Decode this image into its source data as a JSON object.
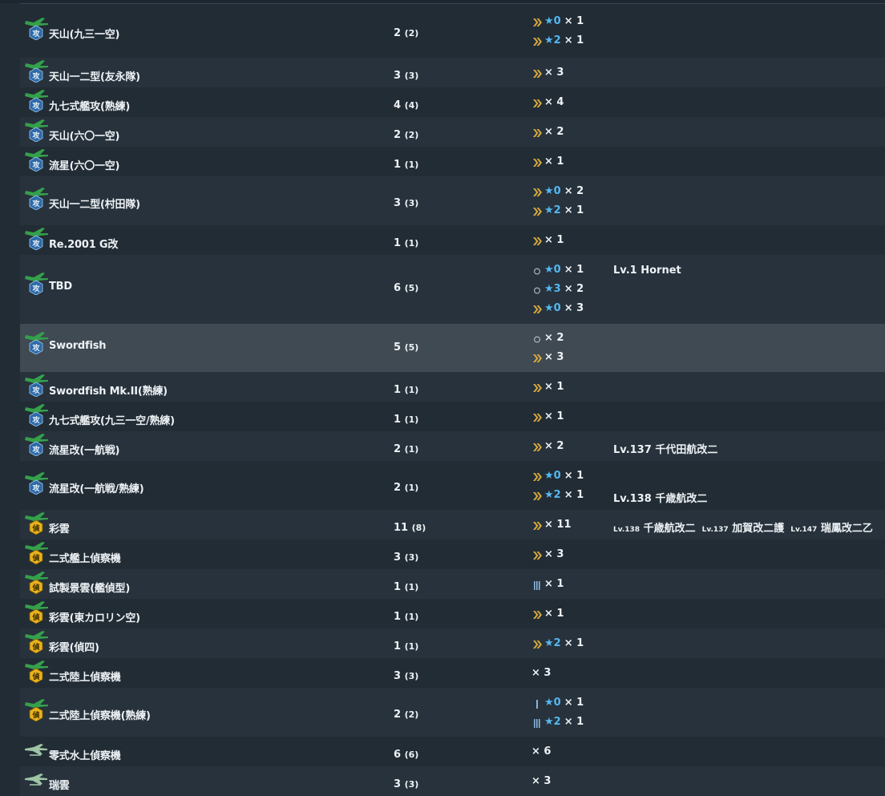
{
  "colors": {
    "background": "#222c35",
    "row_alt": "#27323c",
    "row_hover": "#404a53",
    "star": "#55b7f0",
    "proficiency_chevron": "#d8ab3c",
    "proficiency_bar": "#8ab4dc",
    "torpedo_badge": "#2e6aa8",
    "recon_badge": "#e8b21c",
    "plane": "#35a04b",
    "seaplane": "#9fc4a6"
  },
  "rows": [
    {
      "name": "天山(九三一空)",
      "count": "2",
      "count_paren": "(2)",
      "icon": "torpedo-bomber-icon",
      "prof": [
        {
          "icon": "chevron",
          "star": "★0",
          "mult": "× 1"
        },
        {
          "icon": "chevron",
          "star": "★2",
          "mult": "× 1"
        }
      ],
      "owners": []
    },
    {
      "name": "天山一二型(友永隊)",
      "count": "3",
      "count_paren": "(3)",
      "icon": "torpedo-bomber-icon",
      "prof": [
        {
          "icon": "chevron",
          "star": "",
          "mult": "× 3"
        }
      ],
      "owners": []
    },
    {
      "name": "九七式艦攻(熟練)",
      "count": "4",
      "count_paren": "(4)",
      "icon": "torpedo-bomber-icon",
      "prof": [
        {
          "icon": "chevron",
          "star": "",
          "mult": "× 4"
        }
      ],
      "owners": []
    },
    {
      "name": "天山(六〇一空)",
      "count": "2",
      "count_paren": "(2)",
      "icon": "torpedo-bomber-icon",
      "prof": [
        {
          "icon": "chevron",
          "star": "",
          "mult": "× 2"
        }
      ],
      "owners": []
    },
    {
      "name": "流星(六〇一空)",
      "count": "1",
      "count_paren": "(1)",
      "icon": "torpedo-bomber-icon",
      "prof": [
        {
          "icon": "chevron",
          "star": "",
          "mult": "× 1"
        }
      ],
      "owners": []
    },
    {
      "name": "天山一二型(村田隊)",
      "count": "3",
      "count_paren": "(3)",
      "icon": "torpedo-bomber-icon",
      "prof": [
        {
          "icon": "chevron",
          "star": "★0",
          "mult": "× 2"
        },
        {
          "icon": "chevron",
          "star": "★2",
          "mult": "× 1"
        }
      ],
      "owners": []
    },
    {
      "name": "Re.2001 G改",
      "count": "1",
      "count_paren": "(1)",
      "icon": "torpedo-bomber-icon",
      "prof": [
        {
          "icon": "chevron",
          "star": "",
          "mult": "× 1"
        }
      ],
      "owners": []
    },
    {
      "name": "TBD",
      "count": "6",
      "count_paren": "(5)",
      "icon": "torpedo-bomber-icon",
      "prof": [
        {
          "icon": "circle",
          "star": "★0",
          "mult": "× 1",
          "owner": {
            "lv": "Lv.1",
            "ship": "Hornet"
          }
        },
        {
          "icon": "circle",
          "star": "★3",
          "mult": "× 2"
        },
        {
          "icon": "chevron",
          "star": "★0",
          "mult": "× 3"
        }
      ],
      "owners": []
    },
    {
      "name": "Swordfish",
      "count": "5",
      "count_paren": "(5)",
      "icon": "torpedo-bomber-icon",
      "prof": [
        {
          "icon": "circle",
          "star": "",
          "mult": "× 2"
        },
        {
          "icon": "chevron",
          "star": "",
          "mult": "× 3"
        }
      ],
      "owners": []
    },
    {
      "name": "Swordfish Mk.II(熟練)",
      "count": "1",
      "count_paren": "(1)",
      "icon": "torpedo-bomber-icon",
      "prof": [
        {
          "icon": "chevron",
          "star": "",
          "mult": "× 1"
        }
      ],
      "owners": []
    },
    {
      "name": "九七式艦攻(九三一空/熟練)",
      "count": "1",
      "count_paren": "(1)",
      "icon": "torpedo-bomber-icon",
      "prof": [
        {
          "icon": "chevron",
          "star": "",
          "mult": "× 1"
        }
      ],
      "owners": []
    },
    {
      "name": "流星改(一航戦)",
      "count": "2",
      "count_paren": "(1)",
      "icon": "torpedo-bomber-icon",
      "prof": [
        {
          "icon": "chevron",
          "star": "",
          "mult": "× 2",
          "owner": {
            "lv": "Lv.137",
            "ship": "千代田航改二"
          }
        }
      ],
      "owners": []
    },
    {
      "name": "流星改(一航戦/熟練)",
      "count": "2",
      "count_paren": "(1)",
      "icon": "torpedo-bomber-icon",
      "prof": [
        {
          "icon": "chevron",
          "star": "★0",
          "mult": "× 1"
        },
        {
          "icon": "chevron",
          "star": "★2",
          "mult": "× 1",
          "owner": {
            "lv": "Lv.138",
            "ship": "千歳航改二"
          }
        }
      ],
      "owners": []
    },
    {
      "name": "彩雲",
      "count": "11",
      "count_paren": "(8)",
      "icon": "recon-plane-icon",
      "prof": [
        {
          "icon": "chevron",
          "star": "",
          "mult": "× 11"
        }
      ],
      "owners": [
        {
          "lv": "Lv.138",
          "ship": "千歳航改二"
        },
        {
          "lv": "Lv.137",
          "ship": "加賀改二護"
        },
        {
          "lv": "Lv.147",
          "ship": "瑞鳳改二乙"
        }
      ]
    },
    {
      "name": "二式艦上偵察機",
      "count": "3",
      "count_paren": "(3)",
      "icon": "recon-plane-icon",
      "prof": [
        {
          "icon": "chevron",
          "star": "",
          "mult": "× 3"
        }
      ],
      "owners": []
    },
    {
      "name": "試製景雲(艦偵型)",
      "count": "1",
      "count_paren": "(1)",
      "icon": "recon-plane-icon",
      "prof": [
        {
          "icon": "triplebar",
          "star": "",
          "mult": "× 1"
        }
      ],
      "owners": []
    },
    {
      "name": "彩雲(東カロリン空)",
      "count": "1",
      "count_paren": "(1)",
      "icon": "recon-plane-icon",
      "prof": [
        {
          "icon": "chevron",
          "star": "",
          "mult": "× 1"
        }
      ],
      "owners": []
    },
    {
      "name": "彩雲(偵四)",
      "count": "1",
      "count_paren": "(1)",
      "icon": "recon-plane-icon",
      "prof": [
        {
          "icon": "chevron",
          "star": "★2",
          "mult": "× 1"
        }
      ],
      "owners": []
    },
    {
      "name": "二式陸上偵察機",
      "count": "3",
      "count_paren": "(3)",
      "icon": "recon-plane-icon",
      "prof": [
        {
          "icon": "none",
          "star": "",
          "mult": "× 3"
        }
      ],
      "owners": []
    },
    {
      "name": "二式陸上偵察機(熟練)",
      "count": "2",
      "count_paren": "(2)",
      "icon": "recon-plane-icon",
      "prof": [
        {
          "icon": "singlebar",
          "star": "★0",
          "mult": "× 1"
        },
        {
          "icon": "triplebar",
          "star": "★2",
          "mult": "× 1"
        }
      ],
      "owners": []
    },
    {
      "name": "零式水上偵察機",
      "count": "6",
      "count_paren": "(6)",
      "icon": "seaplane-icon",
      "prof": [
        {
          "icon": "none",
          "star": "",
          "mult": "× 6"
        }
      ],
      "owners": []
    },
    {
      "name": "瑞雲",
      "count": "3",
      "count_paren": "(3)",
      "icon": "seaplane-icon",
      "prof": [
        {
          "icon": "none",
          "star": "",
          "mult": "× 3"
        }
      ],
      "owners": []
    }
  ]
}
